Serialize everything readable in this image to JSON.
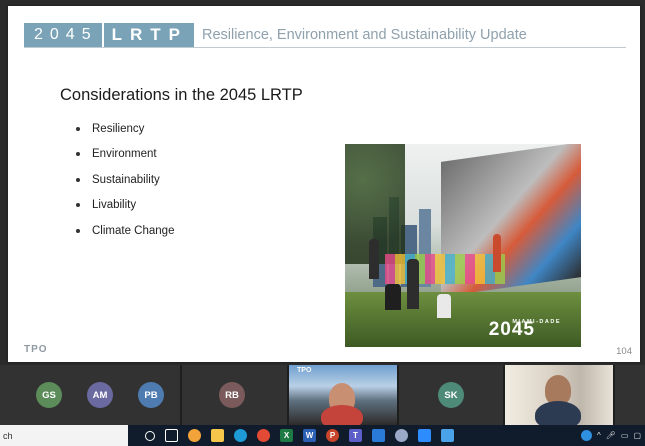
{
  "slide": {
    "header_year": "2045",
    "header_lrtp": "LRTP",
    "header_title": "Resilience, Environment and Sustainability Update",
    "heading": "Considerations in the 2045 LRTP",
    "bullets": [
      "Resiliency",
      "Environment",
      "Sustainability",
      "Livability",
      "Climate Change"
    ],
    "artwork": {
      "label": "MIAMI-DADE",
      "year": "2045"
    },
    "logo": "TPO",
    "page_number": "104"
  },
  "participants": [
    {
      "initials": "GS",
      "color": "#5b8c5a"
    },
    {
      "initials": "AM",
      "color": "#6b6aa0"
    },
    {
      "initials": "PB",
      "color": "#4f7cb0"
    },
    {
      "initials": "RB",
      "color": "#7a5a5a"
    },
    {
      "initials": "SK",
      "color": "#4e8a78"
    }
  ],
  "video_label": "TPO",
  "taskbar": {
    "search_text": "ch",
    "icons": [
      "search-circle",
      "task-view",
      "weather",
      "file-explorer",
      "edge",
      "chrome",
      "excel",
      "word",
      "powerpoint",
      "teams",
      "mail",
      "photos",
      "zoom",
      "folder"
    ],
    "icon_letters": {
      "excel": "X",
      "word": "W",
      "powerpoint": "P",
      "teams": "T"
    }
  }
}
